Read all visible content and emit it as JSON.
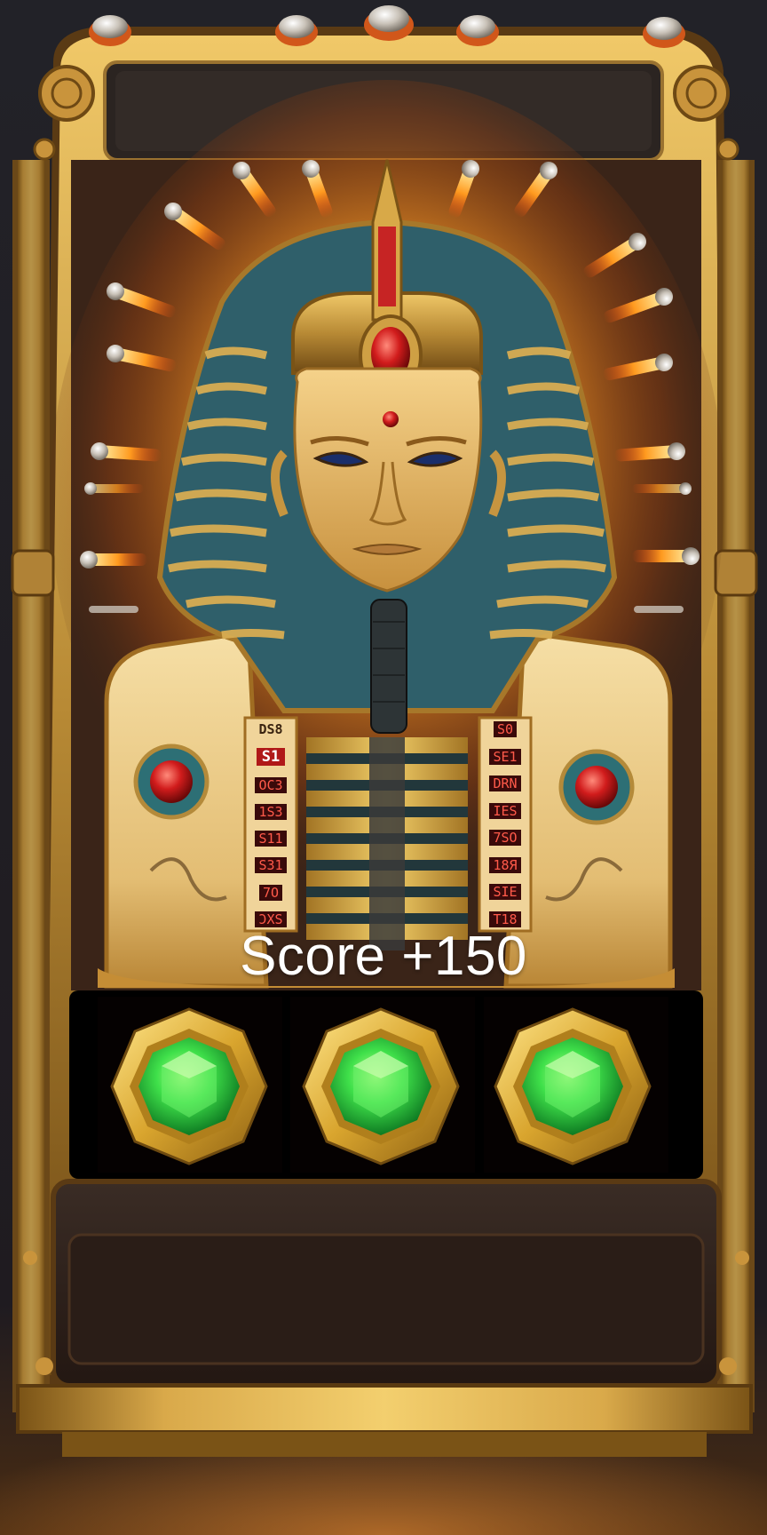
{
  "hud": {
    "score_label": "Score +150"
  },
  "character": {
    "name_icon": "pharaoh-bust",
    "left_panel_glyphs": [
      "DS8",
      "S1",
      "OC3",
      "1S3",
      "S11",
      "S31",
      "7O",
      "ƆΧS"
    ],
    "right_panel_glyphs": [
      "S0",
      "SE1",
      "DRN",
      "IES",
      "7SO",
      "18Я",
      "SIE",
      "T18"
    ]
  },
  "reels": {
    "symbols": [
      {
        "icon": "green-gem-icon"
      },
      {
        "icon": "green-gem-icon"
      },
      {
        "icon": "green-gem-icon"
      }
    ]
  },
  "colors": {
    "gold": "#c99a3c",
    "gold_light": "#f3cf6e",
    "dark_panel": "#2a1d17",
    "gem_green": "#3fe04a",
    "glow_orange": "#ff8a1c",
    "score_text": "#ffffff"
  }
}
